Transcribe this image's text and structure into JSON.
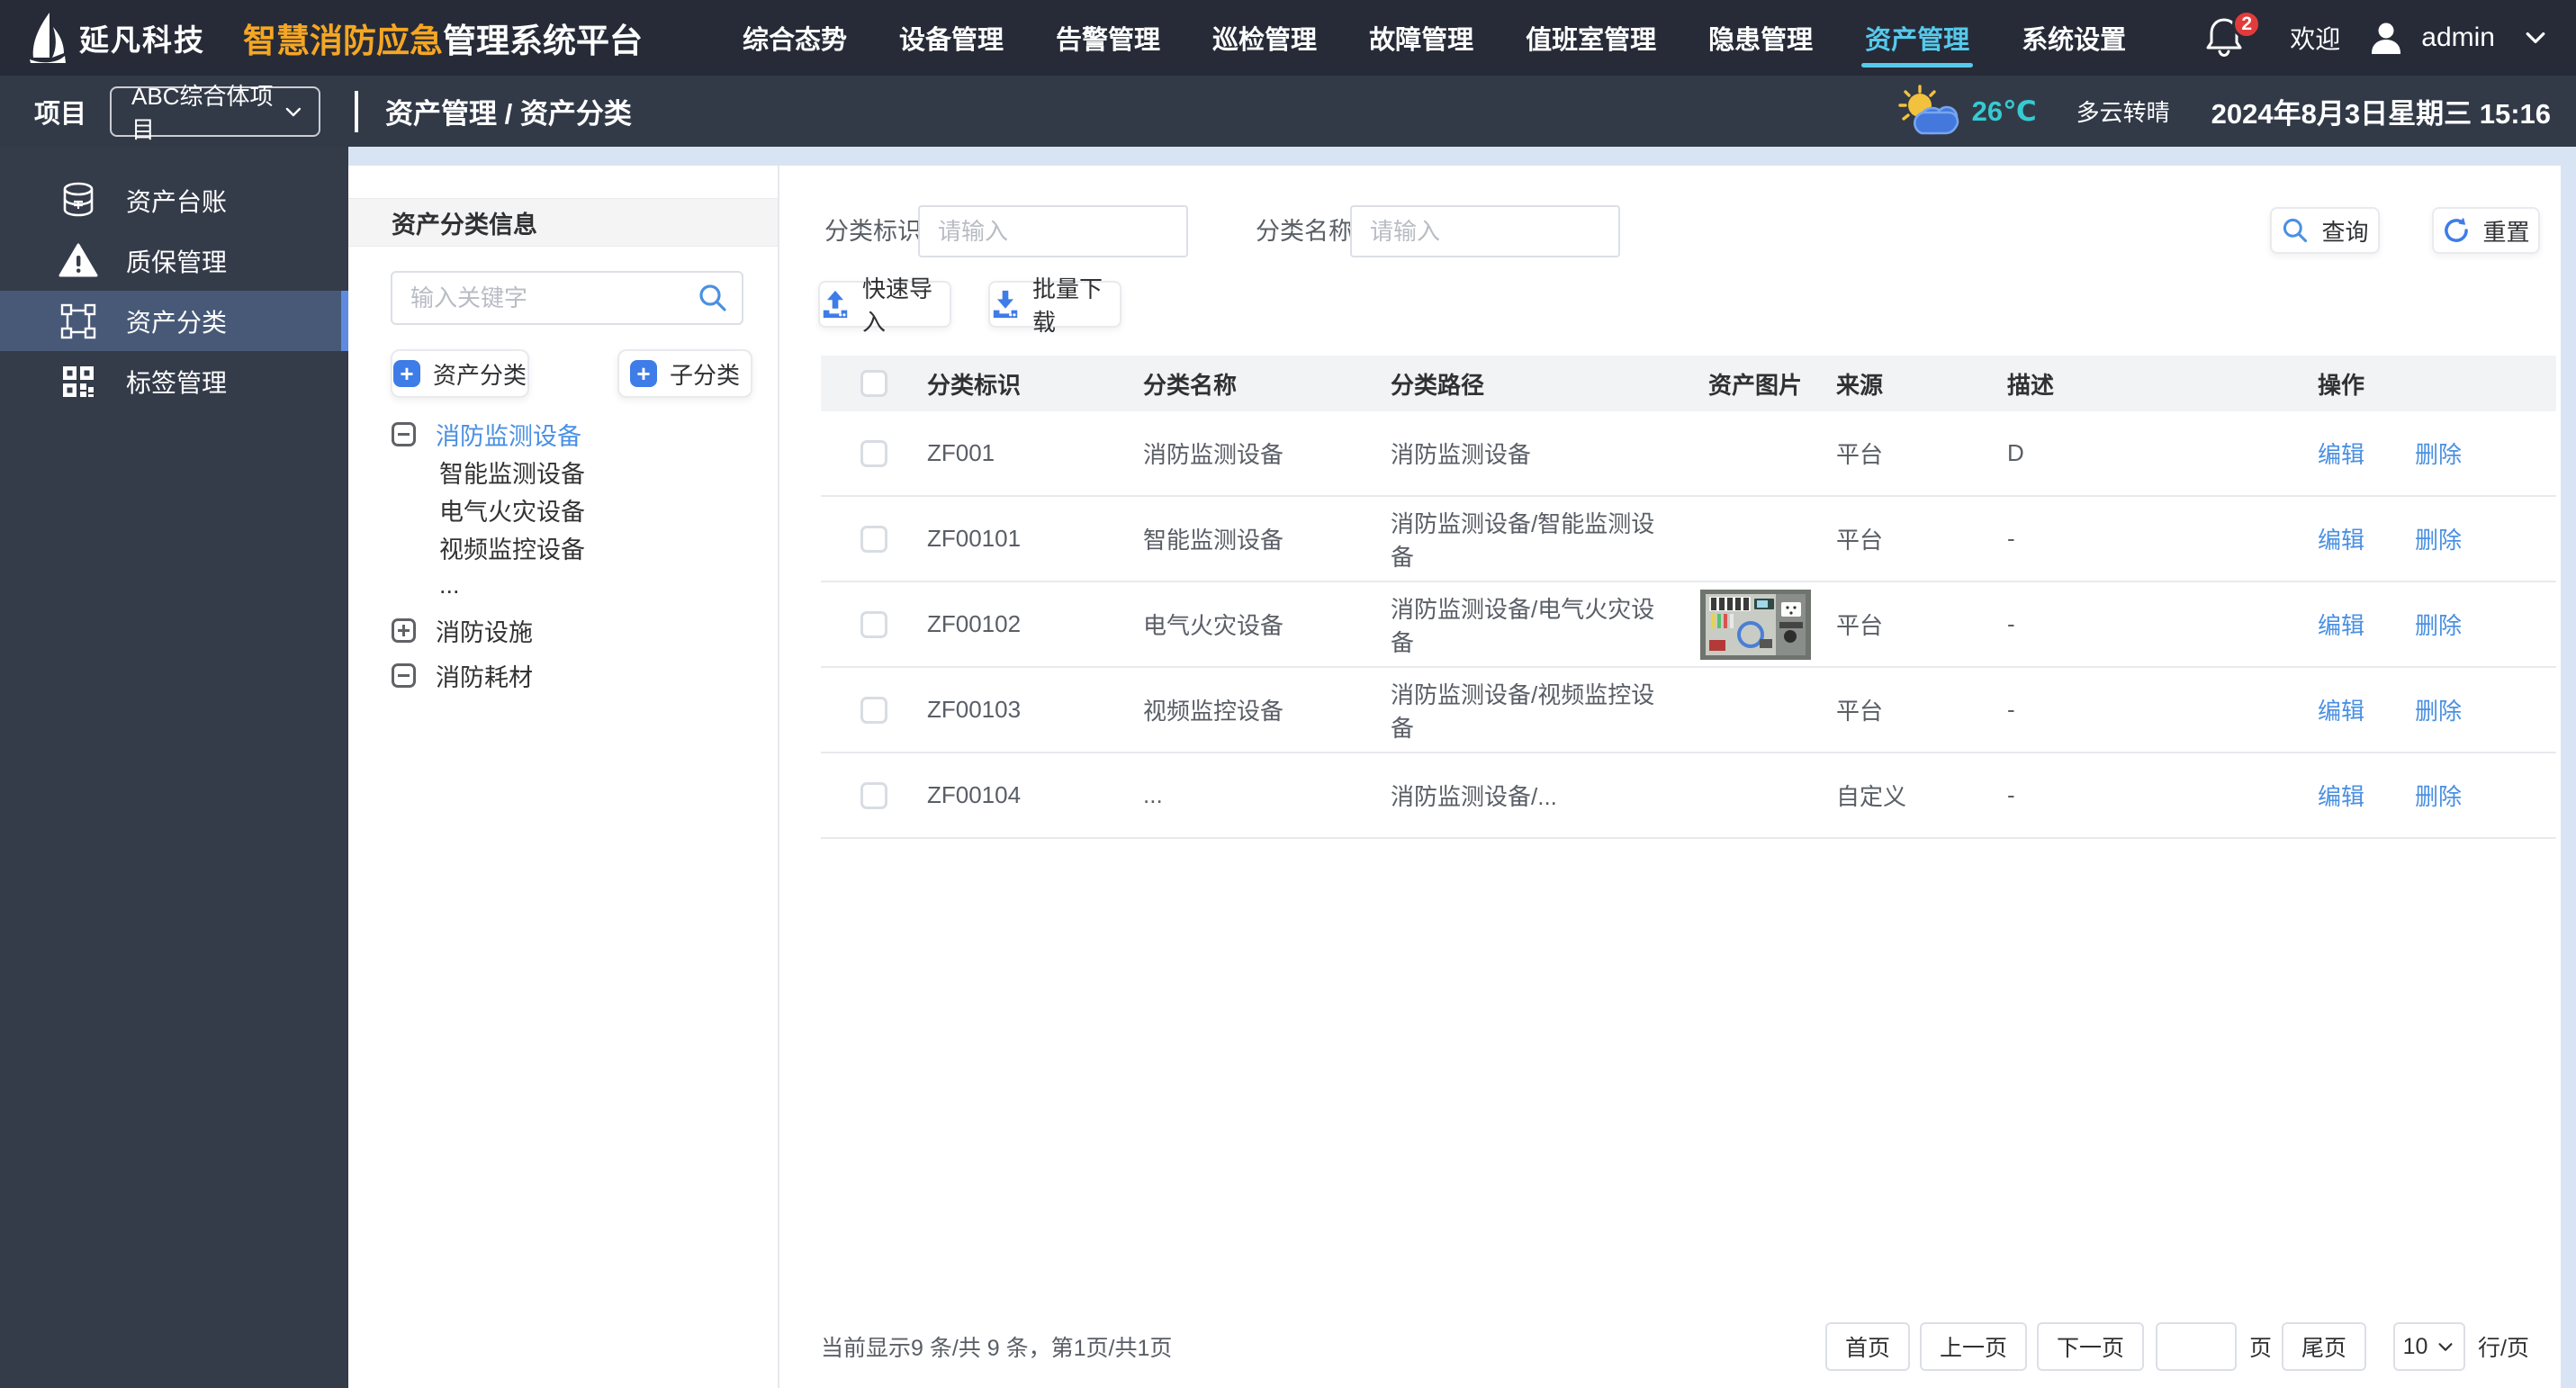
{
  "topbar": {
    "company": "延凡科技",
    "product_highlight": "智慧消防应急",
    "product_rest": "管理系统平台",
    "nav": [
      {
        "label": "综合态势"
      },
      {
        "label": "设备管理"
      },
      {
        "label": "告警管理"
      },
      {
        "label": "巡检管理"
      },
      {
        "label": "故障管理"
      },
      {
        "label": "值班室管理"
      },
      {
        "label": "隐患管理"
      },
      {
        "label": "资产管理",
        "active": true
      },
      {
        "label": "系统设置"
      }
    ],
    "notification_count": "2",
    "welcome": "欢迎",
    "username": "admin"
  },
  "subheader": {
    "project_label": "项目",
    "project_value": "ABC综合体项目",
    "breadcrumb": "资产管理 / 资产分类",
    "temperature": "26℃",
    "weather": "多云转晴",
    "datetime": "2024年8月3日星期三 15:16"
  },
  "sidebar": {
    "items": [
      {
        "label": "资产台账",
        "icon": "ledger-database-icon"
      },
      {
        "label": "质保管理",
        "icon": "warranty-warning-icon"
      },
      {
        "label": "资产分类",
        "icon": "category-object-group-icon",
        "active": true
      },
      {
        "label": "标签管理",
        "icon": "tag-qrcode-icon"
      }
    ]
  },
  "left_panel": {
    "title": "资产分类信息",
    "search_placeholder": "输入关键字",
    "add_category_label": "资产分类",
    "add_subcategory_label": "子分类",
    "plus_glyph": "+",
    "tree": [
      {
        "label": "消防监测设备",
        "toggle": "minus",
        "selected": true
      },
      {
        "label": "智能监测设备",
        "child": true
      },
      {
        "label": "电气火灾设备",
        "child": true
      },
      {
        "label": "视频监控设备",
        "child": true
      },
      {
        "label": "...",
        "child": true
      },
      {
        "label": "消防设施",
        "toggle": "plus"
      },
      {
        "label": "消防耗材",
        "toggle": "minus"
      }
    ]
  },
  "filters": {
    "id_label": "分类标识:",
    "id_placeholder": "请输入",
    "name_label": "分类名称:",
    "name_placeholder": "请输入",
    "query_label": "查询",
    "reset_label": "重置"
  },
  "actions": {
    "import_label": "快速导入",
    "download_label": "批量下载"
  },
  "table": {
    "headers": [
      "分类标识",
      "分类名称",
      "分类路径",
      "资产图片",
      "来源",
      "描述",
      "操作"
    ],
    "edit_label": "编辑",
    "delete_label": "删除",
    "rows": [
      {
        "id": "ZF001",
        "name": "消防监测设备",
        "path": "消防监测设备",
        "source": "平台",
        "description": "D"
      },
      {
        "id": "ZF00101",
        "name": "智能监测设备",
        "path": "消防监测设备/智能监测设备",
        "source": "平台",
        "description": "-"
      },
      {
        "id": "ZF00102",
        "name": "电气火灾设备",
        "path": "消防监测设备/电气火灾设备",
        "source": "平台",
        "description": "-",
        "image": "electrical-panel-photo"
      },
      {
        "id": "ZF00103",
        "name": "视频监控设备",
        "path": "消防监测设备/视频监控设备",
        "source": "平台",
        "description": "-"
      },
      {
        "id": "ZF00104",
        "name": "...",
        "path": "消防监测设备/...",
        "source": "自定义",
        "description": "-"
      }
    ]
  },
  "pagination": {
    "summary": "当前显示9 条/共 9 条，第1页/共1页",
    "first_label": "首页",
    "prev_label": "上一页",
    "next_label": "下一页",
    "page_suffix": "页",
    "last_label": "尾页",
    "page_size": "10",
    "rows_per_page_label": "行/页"
  },
  "colors": {
    "accent_blue": "#3E7CE8",
    "link_blue": "#4A90E2",
    "active_nav_cyan": "#57C9EB",
    "temp_cyan": "#35CBD1",
    "brand_orange": "#F5A623",
    "badge_red": "#E23B3B"
  }
}
